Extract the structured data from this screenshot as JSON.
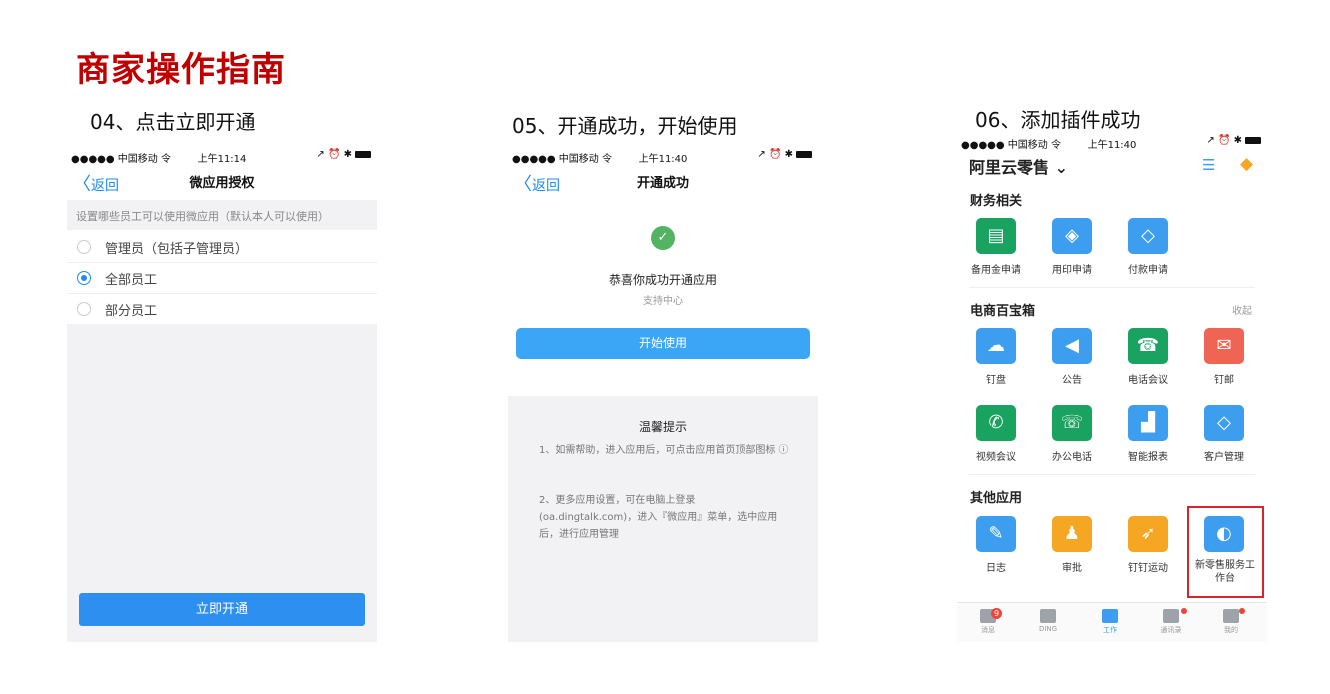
{
  "page_title": "商家操作指南",
  "steps": {
    "s04": "04、点击立即开通",
    "s05": "05、开通成功，开始使用",
    "s06": "06、添加插件成功"
  },
  "status_bar": {
    "p1": {
      "carrier": "●●●●● 中国移动 令",
      "time": "上午11:14",
      "right": "↗ ⏰ ✱"
    },
    "p2": {
      "carrier": "●●●●● 中国移动 令",
      "time": "上午11:40",
      "right": "↗ ⏰ ✱"
    },
    "p3": {
      "carrier": "●●●●● 中国移动 令",
      "time": "上午11:40",
      "right": "↗ ⏰ ✱"
    }
  },
  "screen1": {
    "back": "返回",
    "title": "微应用授权",
    "hint": "设置哪些员工可以使用微应用（默认本人可以使用）",
    "options": [
      "管理员（包括子管理员）",
      "全部员工",
      "部分员工"
    ],
    "selected_index": 1,
    "button": "立即开通"
  },
  "screen2": {
    "back": "返回",
    "title": "开通成功",
    "success_text": "恭喜你成功开通应用",
    "support_link": "支持中心",
    "button": "开始使用",
    "tip_title": "温馨提示",
    "tip1": "1、如需帮助，进入应用后，可点击应用首页顶部图标 ⓘ",
    "tip2": "2、更多应用设置，可在电脑上登录(oa.dingtalk.com)，进入『微应用』菜单，选中应用后，进行应用管理"
  },
  "screen3": {
    "org_name": "阿里云零售 ⌄",
    "sections": [
      {
        "title": "财务相关",
        "apps": [
          {
            "label": "备用金申请",
            "color": "#1aa260",
            "icon": "notebook-icon"
          },
          {
            "label": "用印申请",
            "color": "#3d9ef0",
            "icon": "stamp-icon"
          },
          {
            "label": "付款申请",
            "color": "#3d9ef0",
            "icon": "payment-icon"
          }
        ]
      },
      {
        "title": "电商百宝箱",
        "collapse": "收起",
        "apps": [
          {
            "label": "钉盘",
            "color": "#3d9ef0",
            "icon": "cloud-icon"
          },
          {
            "label": "公告",
            "color": "#3d9ef0",
            "icon": "speaker-icon"
          },
          {
            "label": "电话会议",
            "color": "#1aa260",
            "icon": "phone-conf-icon"
          },
          {
            "label": "钉邮",
            "color": "#f06454",
            "icon": "mail-icon"
          },
          {
            "label": "视频会议",
            "color": "#1aa260",
            "icon": "video-call-icon"
          },
          {
            "label": "办公电话",
            "color": "#1aa260",
            "icon": "office-phone-icon"
          },
          {
            "label": "智能报表",
            "color": "#3d9ef0",
            "icon": "report-icon"
          },
          {
            "label": "客户管理",
            "color": "#3d9ef0",
            "icon": "handshake-icon"
          }
        ]
      },
      {
        "title": "其他应用",
        "apps": [
          {
            "label": "日志",
            "color": "#3d9ef0",
            "icon": "journal-icon"
          },
          {
            "label": "审批",
            "color": "#f5a623",
            "icon": "approval-icon"
          },
          {
            "label": "钉钉运动",
            "color": "#f5a623",
            "icon": "running-icon"
          },
          {
            "label": "新零售服务工作台",
            "color": "#3d9ef0",
            "icon": "retail-icon"
          }
        ]
      }
    ],
    "highlight_color": "#d9232d",
    "tabbar": [
      {
        "label": "消息",
        "badge": "9"
      },
      {
        "label": "DING"
      },
      {
        "label": "工作",
        "active": true
      },
      {
        "label": "通讯录"
      },
      {
        "label": "我的"
      }
    ]
  }
}
